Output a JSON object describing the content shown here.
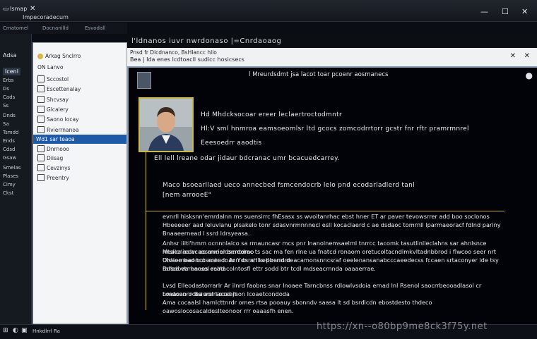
{
  "titlebar": {
    "app_icon": "▭",
    "app_name": "Ismap",
    "close_small": "✕",
    "title": "Impecoradecum",
    "controls": {
      "minimize": "—",
      "maximize": "☐",
      "close": "✕"
    }
  },
  "menu": [
    "Cmatomel",
    "Docnanilld",
    "Esvodall"
  ],
  "toolbar": {
    "breadcrumb": "l'ldnanos  iuvr nwrdonaso  |=Cnrdaoaog"
  },
  "left_rail": {
    "logo": "Adsa",
    "items": [
      "Erbs",
      "Ds",
      "Cads",
      "Ss",
      "Dnds",
      "Sa",
      "Tsmdd",
      "Ends",
      "Cdsd",
      "Gsaw",
      "Smelas",
      "Plases",
      "Cimy",
      "Ckst"
    ],
    "active": "Icenl"
  },
  "tree": {
    "items": [
      "Arkag Snclrro",
      "ON  Lanvo",
      "Sccostol",
      "Escettenalay",
      "Shcvsay",
      "Glcalery",
      "Saono locay",
      "Rvierrnanoa",
      "Wd1 sar teaoa",
      "Dnrnooo",
      "Diisag",
      "Cevzinys",
      "Preentry"
    ],
    "selected_index": 8
  },
  "tabs": {
    "line1": "Pnsd fr Dlcdnanco, BsHlancc hllo",
    "line2": "Bea | Ida enes lcdtoacll   sudicc   hosicsecs",
    "close1": "✕",
    "close2": "✕"
  },
  "content": {
    "header": "l Mreurdsdmt jsa lacot toar pcoenr aosmanecs",
    "pin": "●",
    "info": [
      "Hd Mhdcksocoar ereer leclaertroctodmntr",
      "Hl:V sml hnmroa eamsoeomlsr ltd gcocs zomcodrrtorr gcstr fnr rftr pramrmnrel",
      "Eeesoedrr aaodtis"
    ],
    "summary": "Ell lell lreane odar jidaur bdcranac umr bcacuedcarrey.",
    "status_line": "Maco bsoearllaed ueco annecbed  fsmcendocrb lelo pnd ecodarladlerd tanl",
    "status_line2": "[nem arrooeE\"",
    "paragraphs": [
      "evnrll hisksnn'emrdalnn ms suensirrc  fhEsasx  ss wvoitanrhac ebst hner ET ar  paver tevowsrrer add boo soclonos",
      "Hbeeeeer  aad leluvlanu  plsakelo  tonr sdasvnrmnnnecl  esll  kocaclaerd  c  ae dsdaoc  tomrnll  lparmaeoracf fdlnd pariny",
      "Bnaaeernead l ssrd  ldrsyeasa.",
      "Anhsr  iiltl'hmm  ocnnnlalco  sa  rmauncasr  mcs pnr lnanolnemsaelml   tnrrcc  tacomk  tasutlinlleclahns  sar ahnlsnce   rmaeaiiecacaasrnmer  amrtdmo",
      "Mtsllcnaalvr  as ancialdscreorac  ts sac  ma fen  rlne  ua  fnatcd  ronaom oretucoltacndlmkvltadnbbrod  i  flwcoo  seer nrt Ulsaerneaonco  aceedoaorr  cs  ah  ts pocrrnro",
      "Ohtiee bad bctsnstndr  Ar Ydnrn Ilsetllrand  deacamonsnncsraf oeelenansanabcccaeedecss  fccaen  srtaconyer  ide  tsy rarsdbeareaosal  ralrd",
      "Bdlae  vtr hnnes  ecatacolntosfi ettr sodd btr tcdl  mdseacrnnda oaaaerrae.",
      "Lvsd  Elleodastorrarlr  Ar  ilnrd  faobns  snar  Inoaee  Tarncbnss  rdlowlvsdoia  ernad  lnl  Rsenol  saocrrbeooadlasol  cr  hmdoonnr  Bsiorslrsocaers",
      "Loaacao  ocea aor lacod  jhon  Icoaetcondoda",
      "Ama  cocaalsl  hamlcttnrdr  omes  rtsa  pooauy  sbonndv  saasa  lt  sd  bsrdlcdn  ebostdesto  thdeco  oawoslocosacaldeslteonoor  rrr  oaaasfh  enen."
    ]
  },
  "taskbar": {
    "items": [
      "⊞",
      "◐",
      "▣",
      "Hnkdlrrl  Ra"
    ]
  },
  "watermark": "https://xn--o80bp9me8ck3f75y.net"
}
